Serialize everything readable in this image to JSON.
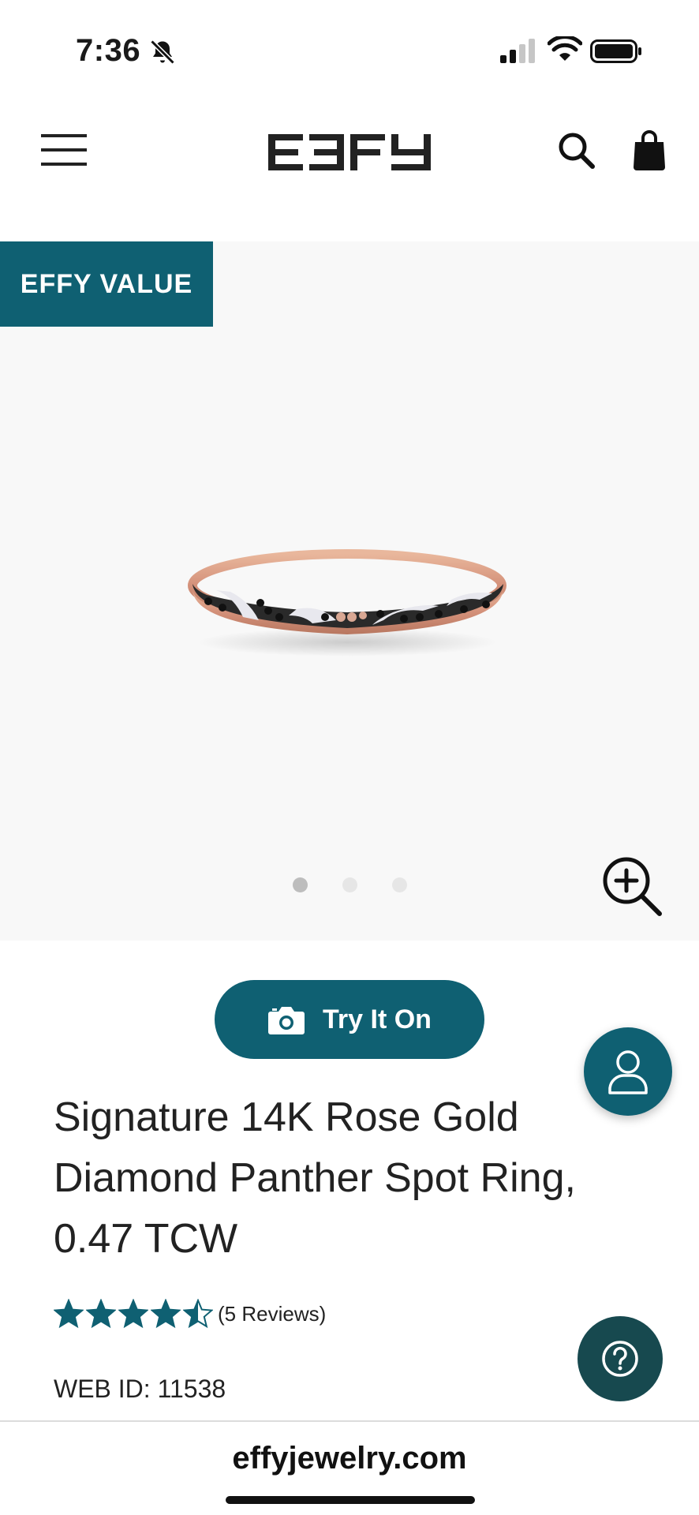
{
  "status_bar": {
    "time": "7:36",
    "icons": [
      "bell-slash-icon",
      "cellular-signal-icon",
      "wifi-icon",
      "battery-icon"
    ]
  },
  "header": {
    "logo_text": "EFFY",
    "icons": [
      "hamburger-menu-icon",
      "search-icon",
      "shopping-bag-icon"
    ]
  },
  "gallery": {
    "badge": "EFFY VALUE",
    "image_count": 3,
    "active_image": 1,
    "zoom_icon": "zoom-in-icon"
  },
  "try_on": {
    "label": "Try It On",
    "icon": "camera-icon"
  },
  "product": {
    "title": "Signature 14K Rose Gold Diamond Panther Spot Ring, 0.47 TCW",
    "rating": 4.5,
    "rating_max": 5,
    "reviews_text": "(5 Reviews)",
    "web_id": "WEB ID: 11538"
  },
  "floating": {
    "account_icon": "user-icon",
    "help_icon": "help-question-icon"
  },
  "browser": {
    "url": "effyjewelry.com"
  },
  "colors": {
    "brand_teal": "#0f6072",
    "help_teal": "#17494f",
    "star_color": "#0f6072",
    "gallery_bg": "#f8f8f8"
  }
}
